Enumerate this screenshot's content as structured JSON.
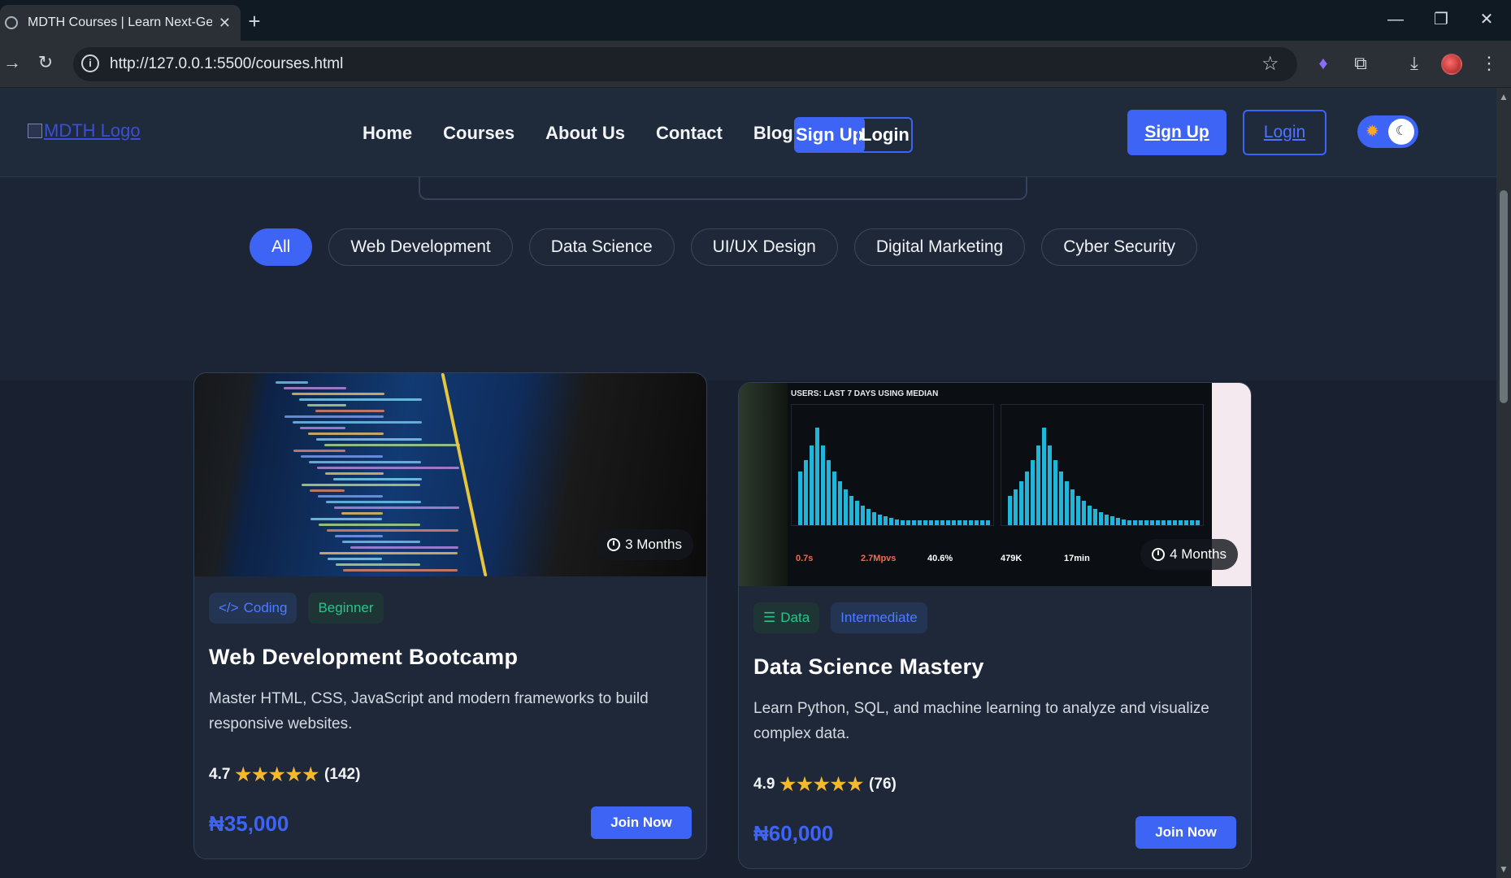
{
  "browser": {
    "tab_title": "MDTH Courses | Learn Next-Gen",
    "url": "http://127.0.0.1:5500/courses.html"
  },
  "header": {
    "logo_alt": "MDTH Logo",
    "nav": [
      "Home",
      "Courses",
      "About Us",
      "Contact",
      "Blog"
    ],
    "mini_signup": "Sign Up",
    "mini_login": "Login",
    "signup": "Sign Up",
    "login": "Login"
  },
  "filters": [
    "All",
    "Web Development",
    "Data Science",
    "UI/UX Design",
    "Digital Marketing",
    "Cyber Security"
  ],
  "active_filter": "All",
  "courses": [
    {
      "duration": "3 Months",
      "category": "Coding",
      "level": "Beginner",
      "title": "Web Development Bootcamp",
      "description": "Master HTML, CSS, JavaScript and modern frameworks to build responsive websites.",
      "rating": "4.7",
      "stars": 5,
      "reviews": "(142)",
      "price": "₦35,000",
      "cta": "Join Now"
    },
    {
      "duration": "4 Months",
      "category": "Data",
      "level": "Intermediate",
      "title": "Data Science Mastery",
      "description": "Learn Python, SQL, and machine learning to analyze and visualize complex data.",
      "rating": "4.9",
      "stars": 5,
      "reviews": "(76)",
      "price": "₦60,000",
      "cta": "Join Now"
    }
  ],
  "dashboard_image": {
    "title": "USERS: LAST 7 DAYS USING MEDIAN",
    "metrics": [
      "0.7s",
      "2.7Mpvs",
      "40.6%",
      "479K",
      "17min"
    ]
  },
  "colors": {
    "accent": "#3d64f4",
    "star": "#f5b82e",
    "tag_green": "#2bc48a"
  }
}
